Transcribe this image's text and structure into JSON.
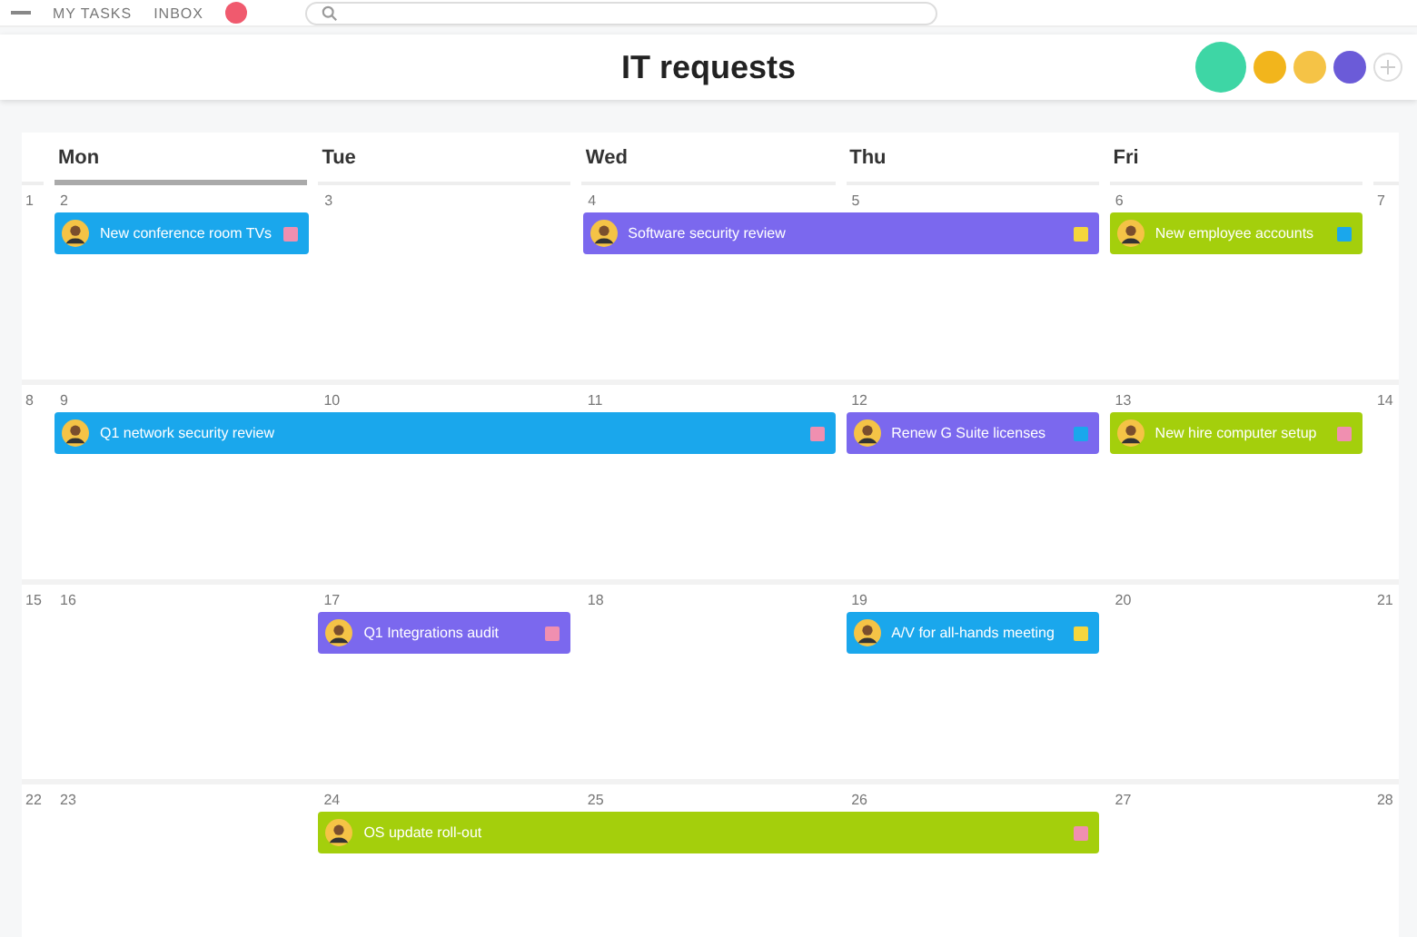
{
  "nav": {
    "links": [
      "MY TASKS",
      "INBOX"
    ]
  },
  "header": {
    "title": "IT requests"
  },
  "weekdays": [
    {
      "label": "Mon",
      "selected": true
    },
    {
      "label": "Tue",
      "selected": false
    },
    {
      "label": "Wed",
      "selected": false
    },
    {
      "label": "Thu",
      "selected": false
    },
    {
      "label": "Fri",
      "selected": false
    }
  ],
  "weeks": [
    {
      "sunday": "1",
      "saturday": "7",
      "days": [
        {
          "number": "2",
          "bar": {
            "kind": "start",
            "title": "New conference room TVs",
            "color": "#1aa7ec",
            "tag": {
              "color": "#f08fb0"
            }
          }
        },
        {
          "number": "3"
        },
        {
          "number": "4",
          "bar": {
            "kind": "start",
            "title": "Software security review",
            "color": "#7b68ee",
            "tag": {
              "color": "#f5d63d"
            }
          }
        },
        {
          "number": "5",
          "bar": {
            "kind": "continuation"
          }
        },
        {
          "number": "6",
          "bar": {
            "kind": "start",
            "title": "New employee accounts",
            "color": "#a4cf0c",
            "tag": {
              "color": "#1aa7ec"
            }
          }
        }
      ]
    },
    {
      "sunday": "8",
      "saturday": "14",
      "days": [
        {
          "number": "9",
          "bar": {
            "kind": "start",
            "title": "Q1 network security review",
            "color": "#1aa7ec",
            "tag": {
              "color": "#f08fb0"
            }
          }
        },
        {
          "number": "10",
          "bar": {
            "kind": "continuation"
          }
        },
        {
          "number": "11",
          "bar": {
            "kind": "continuation"
          }
        },
        {
          "number": "12",
          "bar": {
            "kind": "start",
            "title": "Renew G Suite licenses",
            "color": "#7b68ee",
            "tag": {
              "color": "#1aa7ec"
            }
          }
        },
        {
          "number": "13",
          "bar": {
            "kind": "start",
            "title": "New hire computer setup",
            "color": "#a4cf0c",
            "tag": {
              "color": "#f08fb0"
            }
          }
        }
      ]
    },
    {
      "sunday": "15",
      "saturday": "21",
      "days": [
        {
          "number": "16"
        },
        {
          "number": "17",
          "bar": {
            "kind": "start",
            "title": "Q1 Integrations audit",
            "color": "#7b68ee",
            "tag": {
              "color": "#f08fb0"
            }
          }
        },
        {
          "number": "18"
        },
        {
          "number": "19",
          "bar": {
            "kind": "start",
            "title": "A/V for all-hands meeting",
            "color": "#1aa7ec",
            "tag": {
              "color": "#f5d63d"
            }
          }
        },
        {
          "number": "20"
        }
      ]
    },
    {
      "sunday": "22",
      "saturday": "28",
      "days": [
        {
          "number": "23"
        },
        {
          "number": "24",
          "bar": {
            "kind": "start",
            "title": "OS update roll-out",
            "color": "#a4cf0c",
            "tag": {
              "color": "#f08fb0"
            }
          }
        },
        {
          "number": "25",
          "bar": {
            "kind": "continuation"
          }
        },
        {
          "number": "26",
          "bar": {
            "kind": "continuation"
          }
        },
        {
          "number": "27"
        }
      ]
    }
  ]
}
